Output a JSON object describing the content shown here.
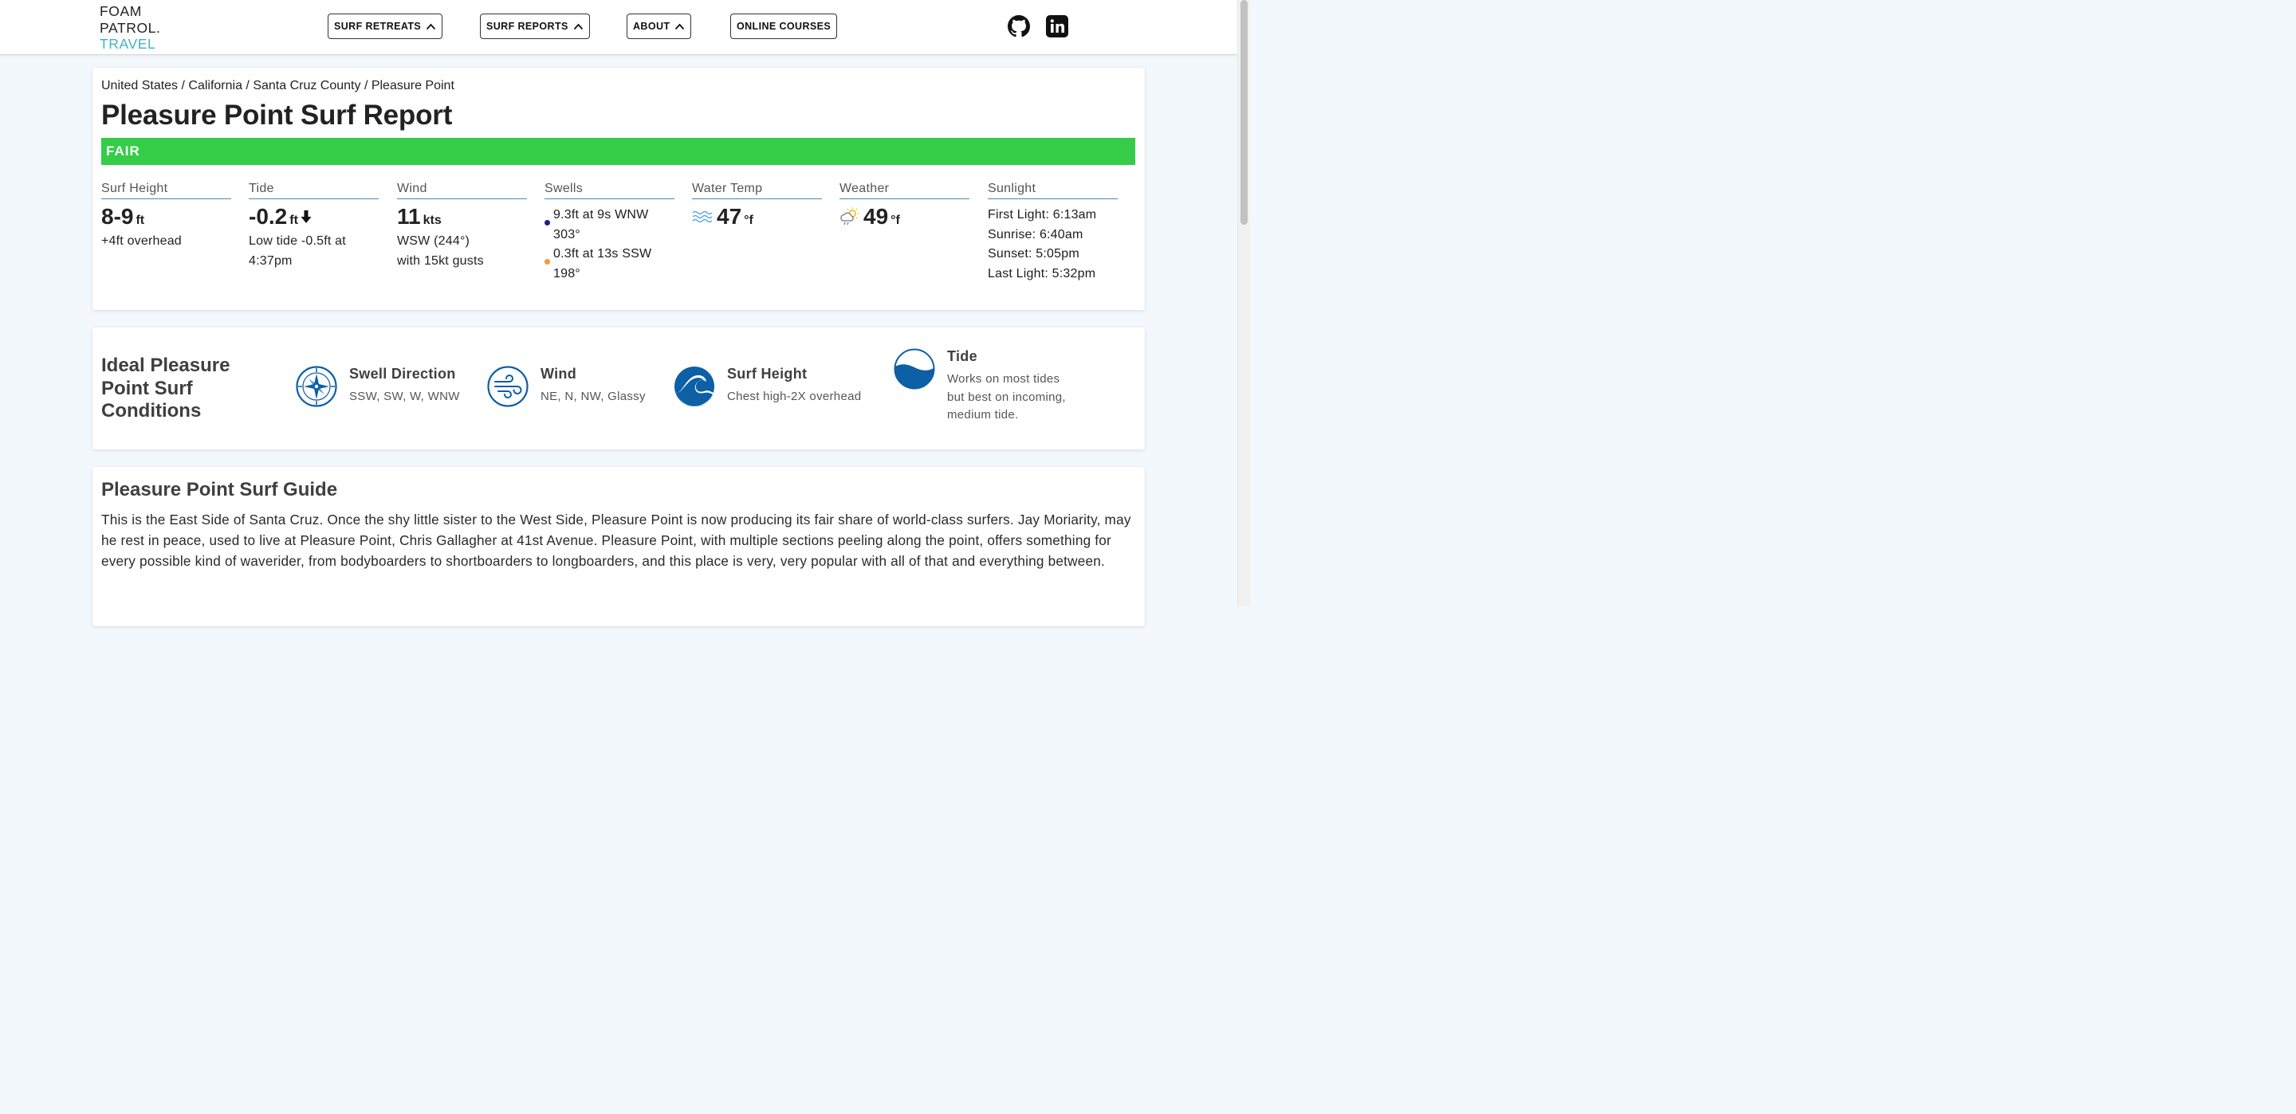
{
  "header": {
    "logo": {
      "line1": "FOAM",
      "line2": "PATROL.",
      "line3": "TRAVEL"
    },
    "nav": [
      {
        "label": "SURF RETREATS",
        "has_chevron": true
      },
      {
        "label": "SURF REPORTS",
        "has_chevron": true
      },
      {
        "label": "ABOUT",
        "has_chevron": true
      },
      {
        "label": "ONLINE COURSES",
        "has_chevron": false
      }
    ],
    "social_icons": [
      "github-icon",
      "linkedin-icon"
    ]
  },
  "report": {
    "breadcrumb": "United States / California / Santa Cruz County / Pleasure Point",
    "title": "Pleasure Point Surf Report",
    "rating": "FAIR",
    "rating_color": "#35cc48",
    "surf_height": {
      "label": "Surf Height",
      "value": "8-9",
      "unit": "ft",
      "sub": "+4ft overhead"
    },
    "tide": {
      "label": "Tide",
      "value": "-0.2",
      "unit": "ft",
      "direction_icon": "arrow-down-icon",
      "sub": "Low tide -0.5ft at 4:37pm"
    },
    "wind": {
      "label": "Wind",
      "value": "11",
      "unit": "kts",
      "sub1": "WSW (244°)",
      "sub2": "with 15kt gusts"
    },
    "swells": {
      "label": "Swells",
      "items": [
        {
          "line1": "9.3ft at 9s WNW",
          "line2": "303°",
          "dot_color": "#1a237e"
        },
        {
          "line1": "0.3ft at 13s SSW",
          "line2": "198°",
          "dot_color": "#f29a3c"
        }
      ]
    },
    "water_temp": {
      "label": "Water Temp",
      "value": "47",
      "unit": "°f",
      "icon": "water-waves-icon"
    },
    "weather": {
      "label": "Weather",
      "value": "49",
      "unit": "°f",
      "icon": "sun-cloud-rain-icon"
    },
    "sunlight": {
      "label": "Sunlight",
      "first_light": "First Light: 6:13am",
      "sunrise": "Sunrise: 6:40am",
      "sunset": "Sunset: 5:05pm",
      "last_light": "Last Light: 5:32pm"
    }
  },
  "conditions": {
    "title": "Ideal Pleasure Point Surf Conditions",
    "items": [
      {
        "label": "Swell Direction",
        "value": "SSW, SW, W, WNW",
        "icon": "compass-icon"
      },
      {
        "label": "Wind",
        "value": "NE, N, NW, Glassy",
        "icon": "wind-icon"
      },
      {
        "label": "Surf Height",
        "value": "Chest high-2X overhead",
        "icon": "wave-icon"
      },
      {
        "label": "Tide",
        "value": "Works on most tides but best on incoming, medium tide.",
        "icon": "tide-icon"
      }
    ],
    "icon_color": "#0d5fa6"
  },
  "guide": {
    "title": "Pleasure Point Surf Guide",
    "text": "This is the East Side of Santa Cruz. Once the shy little sister to the West Side, Pleasure Point is now producing its fair share of world-class surfers. Jay Moriarity, may he rest in peace, used to live at Pleasure Point, Chris Gallagher at 41st Avenue. Pleasure Point, with multiple sections peeling along the point, offers something for every possible kind of waverider, from bodyboarders to shortboarders to longboarders, and this place is very, very popular with all of that and everything between."
  }
}
